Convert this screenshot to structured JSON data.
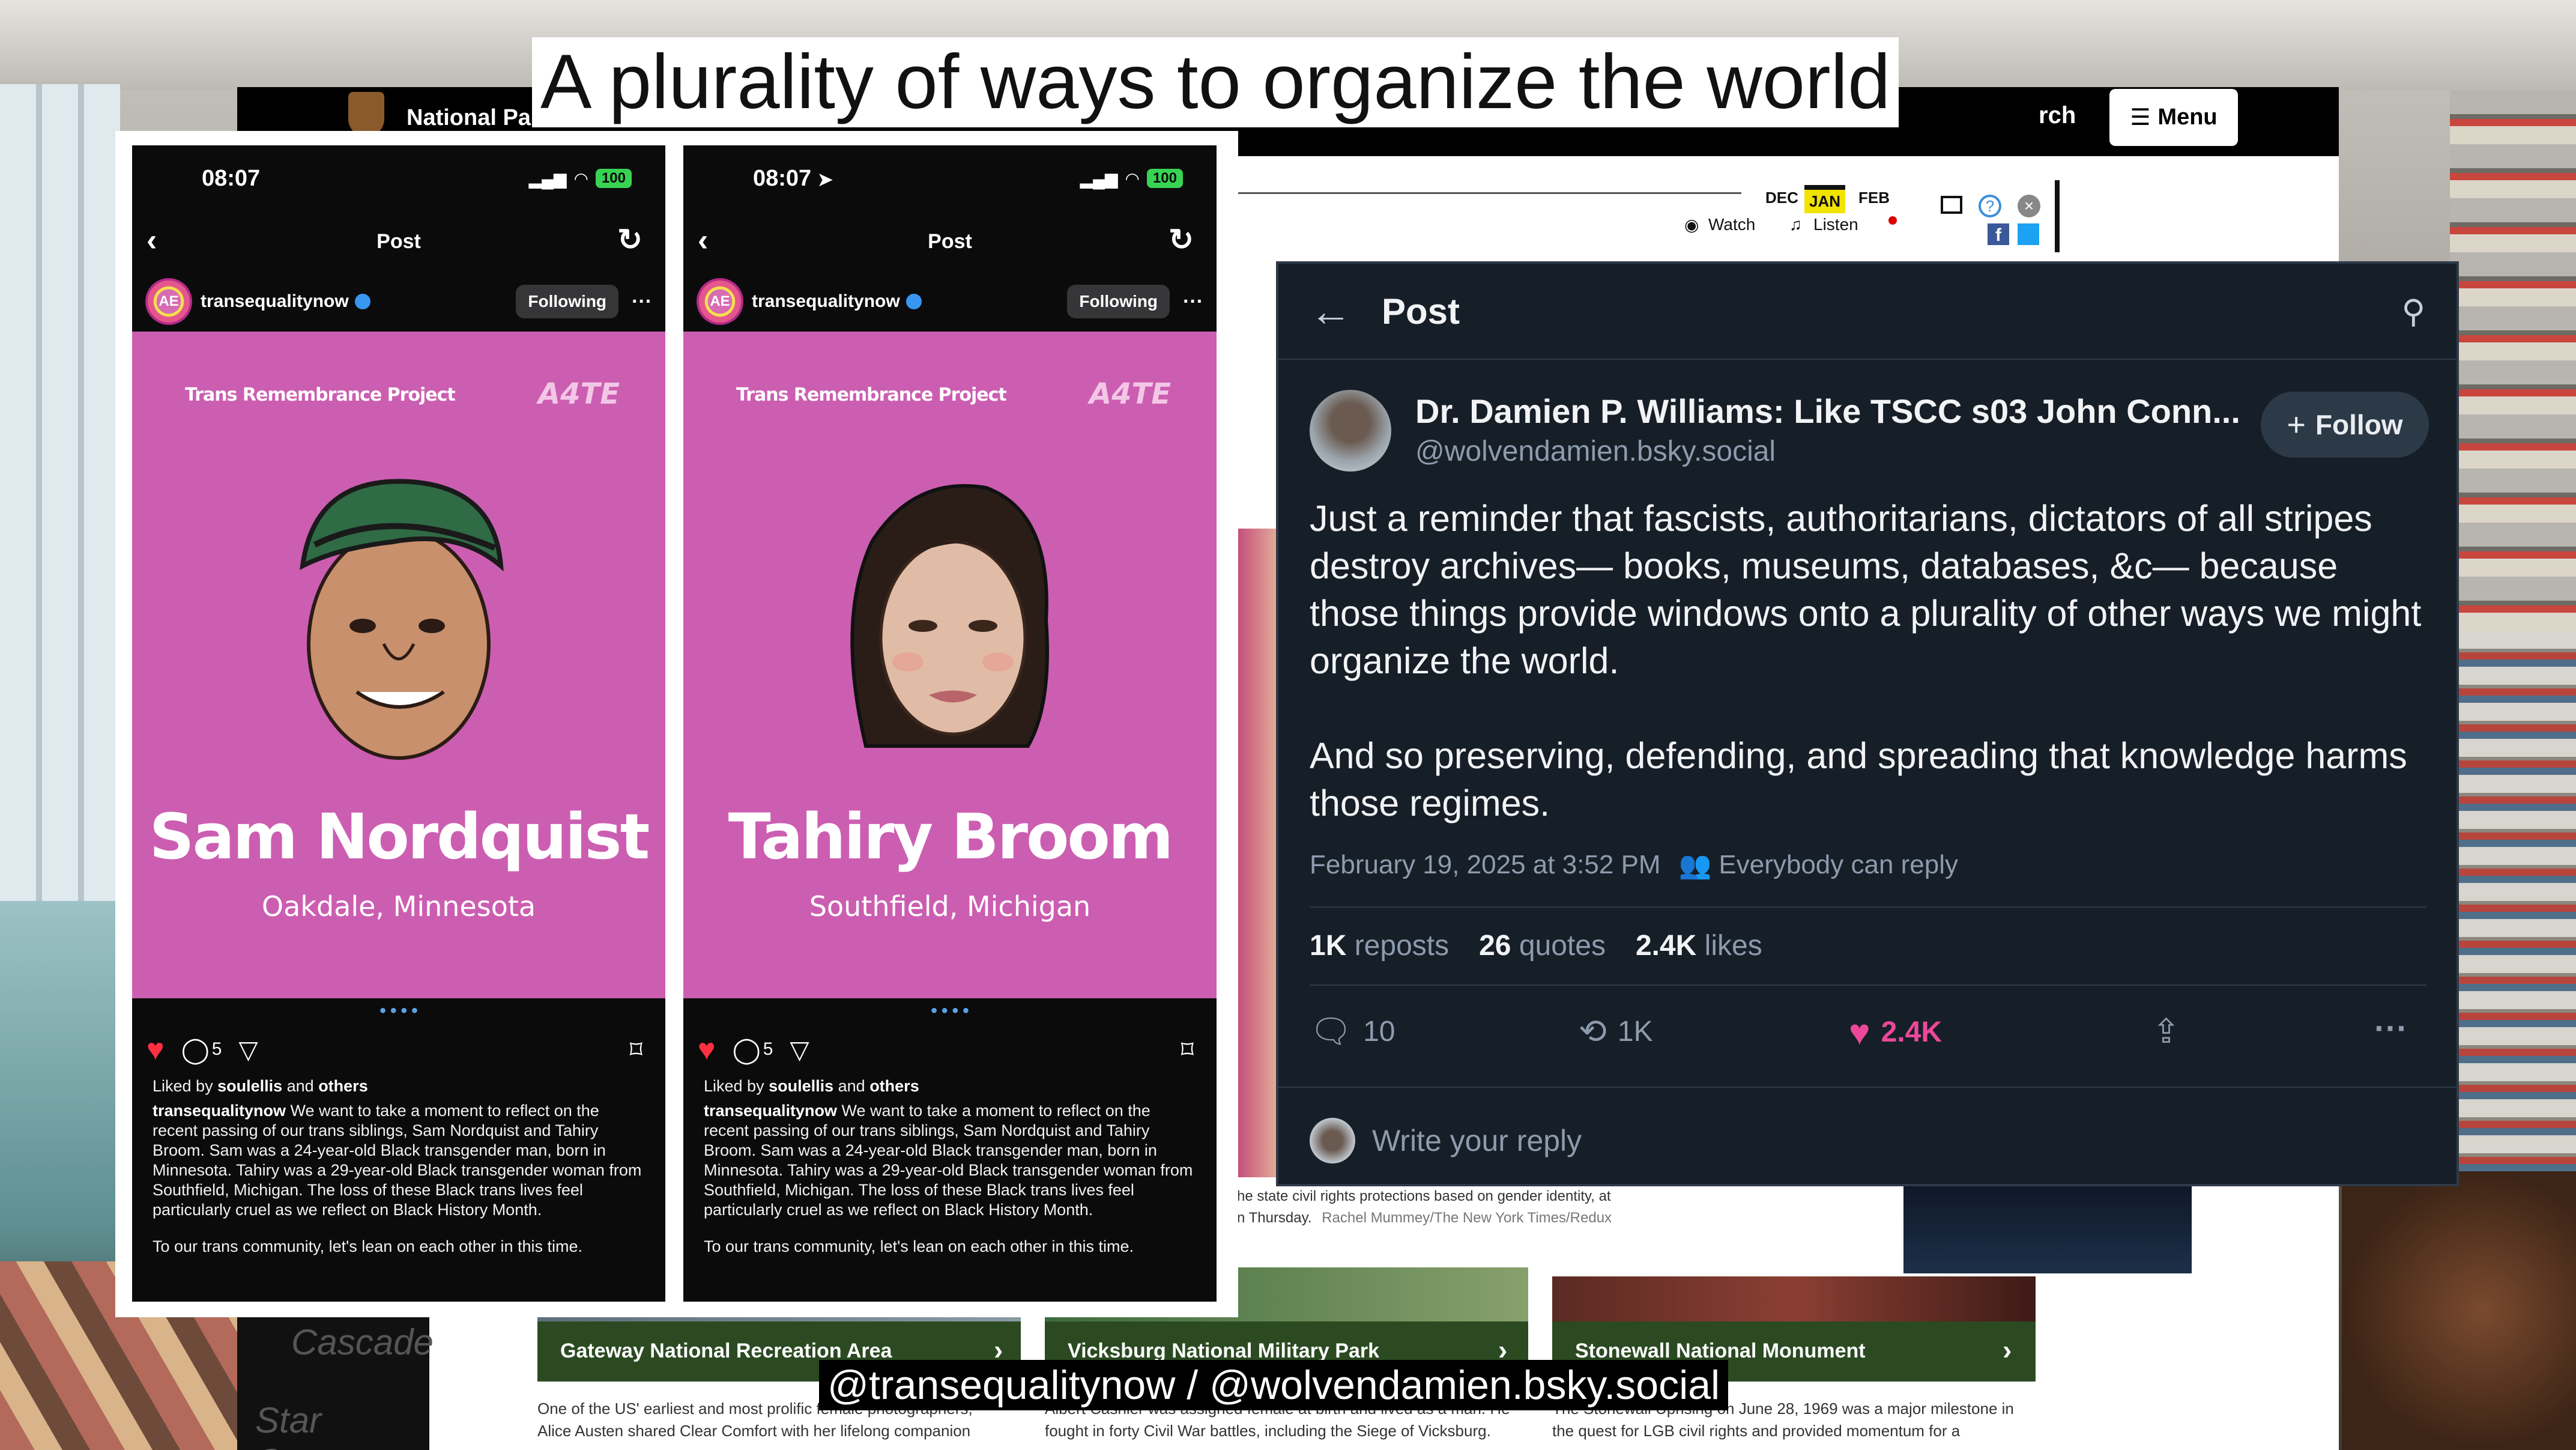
{
  "slide": {
    "title": "A plurality of ways to organize the world",
    "caption": "@transequalitynow / @wolvendamien.bsky.social"
  },
  "nps": {
    "site_title": "National Pa",
    "search_fragment": "rch",
    "menu_label": "Menu",
    "months": [
      "DEC",
      "JAN",
      "FEB"
    ],
    "watch_label": "Watch",
    "listen_label": "Listen",
    "photo_caption": "he state civil rights protections based on gender identity, at",
    "photo_caption_2": "n Thursday.",
    "photo_credit": "Rachel Mummey/The New York Times/Redux",
    "cards": [
      {
        "title": "Gateway National Recreation Area",
        "desc_1": "One of the US' earliest and most prolific female photographers,",
        "desc_2": "Alice Austen shared Clear Comfort with her lifelong companion"
      },
      {
        "title": "Vicksburg National Military Park",
        "desc_1": "Albert Cashier was assigned female at birth and lived as a man. He",
        "desc_2": "fought in forty Civil War battles, including the Siege of Vicksburg."
      },
      {
        "title": "Stonewall National Monument",
        "desc_1": "The Stonewall Uprising on June 28, 1969 was a major milestone in",
        "desc_2": "the quest for LGB civil rights and provided momentum for a"
      }
    ],
    "bg_text_1": "Cascade",
    "bg_text_2": "Star Geyser"
  },
  "ig_posts": [
    {
      "time": "08:07",
      "battery": "100",
      "header": "Post",
      "username": "transequalitynow",
      "following_label": "Following",
      "project": "Trans Remembrance Project",
      "logo": "A4TE",
      "person_name": "Sam Nordquist",
      "location": "Oakdale, Minnesota",
      "comment_count": "5",
      "liked_by_prefix": "Liked by ",
      "liked_by_user": "soulellis",
      "liked_by_suffix": " and ",
      "liked_by_others": "others",
      "caption_user": "transequalitynow",
      "caption_text": " We want to take a moment to reflect on the recent passing of our trans siblings, Sam Nordquist and Tahiry Broom. Sam was a 24-year-old Black transgender man, born in Minnesota. Tahiry was a 29-year-old Black transgender woman from Southfield, Michigan. The loss of these Black trans lives feel particularly cruel as we reflect on Black History Month.",
      "caption_tail": "To our trans community, let's lean on each other in this time."
    },
    {
      "time": "08:07",
      "battery": "100",
      "header": "Post",
      "username": "transequalitynow",
      "following_label": "Following",
      "project": "Trans Remembrance Project",
      "logo": "A4TE",
      "person_name": "Tahiry Broom",
      "location": "Southfield, Michigan",
      "comment_count": "5",
      "liked_by_prefix": "Liked by ",
      "liked_by_user": "soulellis",
      "liked_by_suffix": " and ",
      "liked_by_others": "others",
      "caption_user": "transequalitynow",
      "caption_text": " We want to take a moment to reflect on the recent passing of our trans siblings, Sam Nordquist and Tahiry Broom. Sam was a 24-year-old Black transgender man, born in Minnesota. Tahiry was a 29-year-old Black transgender woman from Southfield, Michigan. The loss of these Black trans lives feel particularly cruel as we reflect on Black History Month.",
      "caption_tail": "To our trans community, let's lean on each other in this time."
    }
  ],
  "bsky": {
    "header": "Post",
    "author_name": "Dr. Damien P. Williams: Like TSCC s03 John Conn...",
    "author_handle": "@wolvendamien.bsky.social",
    "follow_label": "Follow",
    "body_p1": "Just a reminder that fascists, authoritarians, dictators of all stripes destroy archives— books, museums, databases, &c— because those things provide windows onto a plurality of other ways we might organize the world.",
    "body_p2": "And so preserving, defending, and spreading that knowledge harms those regimes.",
    "timestamp": "February 19, 2025 at 3:52 PM",
    "reply_setting": "Everybody can reply",
    "reposts_count": "1K",
    "reposts_label": " reposts",
    "quotes_count": "26",
    "quotes_label": " quotes",
    "likes_count": "2.4K",
    "likes_label": " likes",
    "reply_count": "10",
    "repost_count_action": "1K",
    "like_count_action": "2.4K",
    "reply_placeholder": "Write your reply",
    "colors": {
      "like": "#ec4899",
      "background": "#161e27",
      "muted": "#8d9bad"
    }
  }
}
